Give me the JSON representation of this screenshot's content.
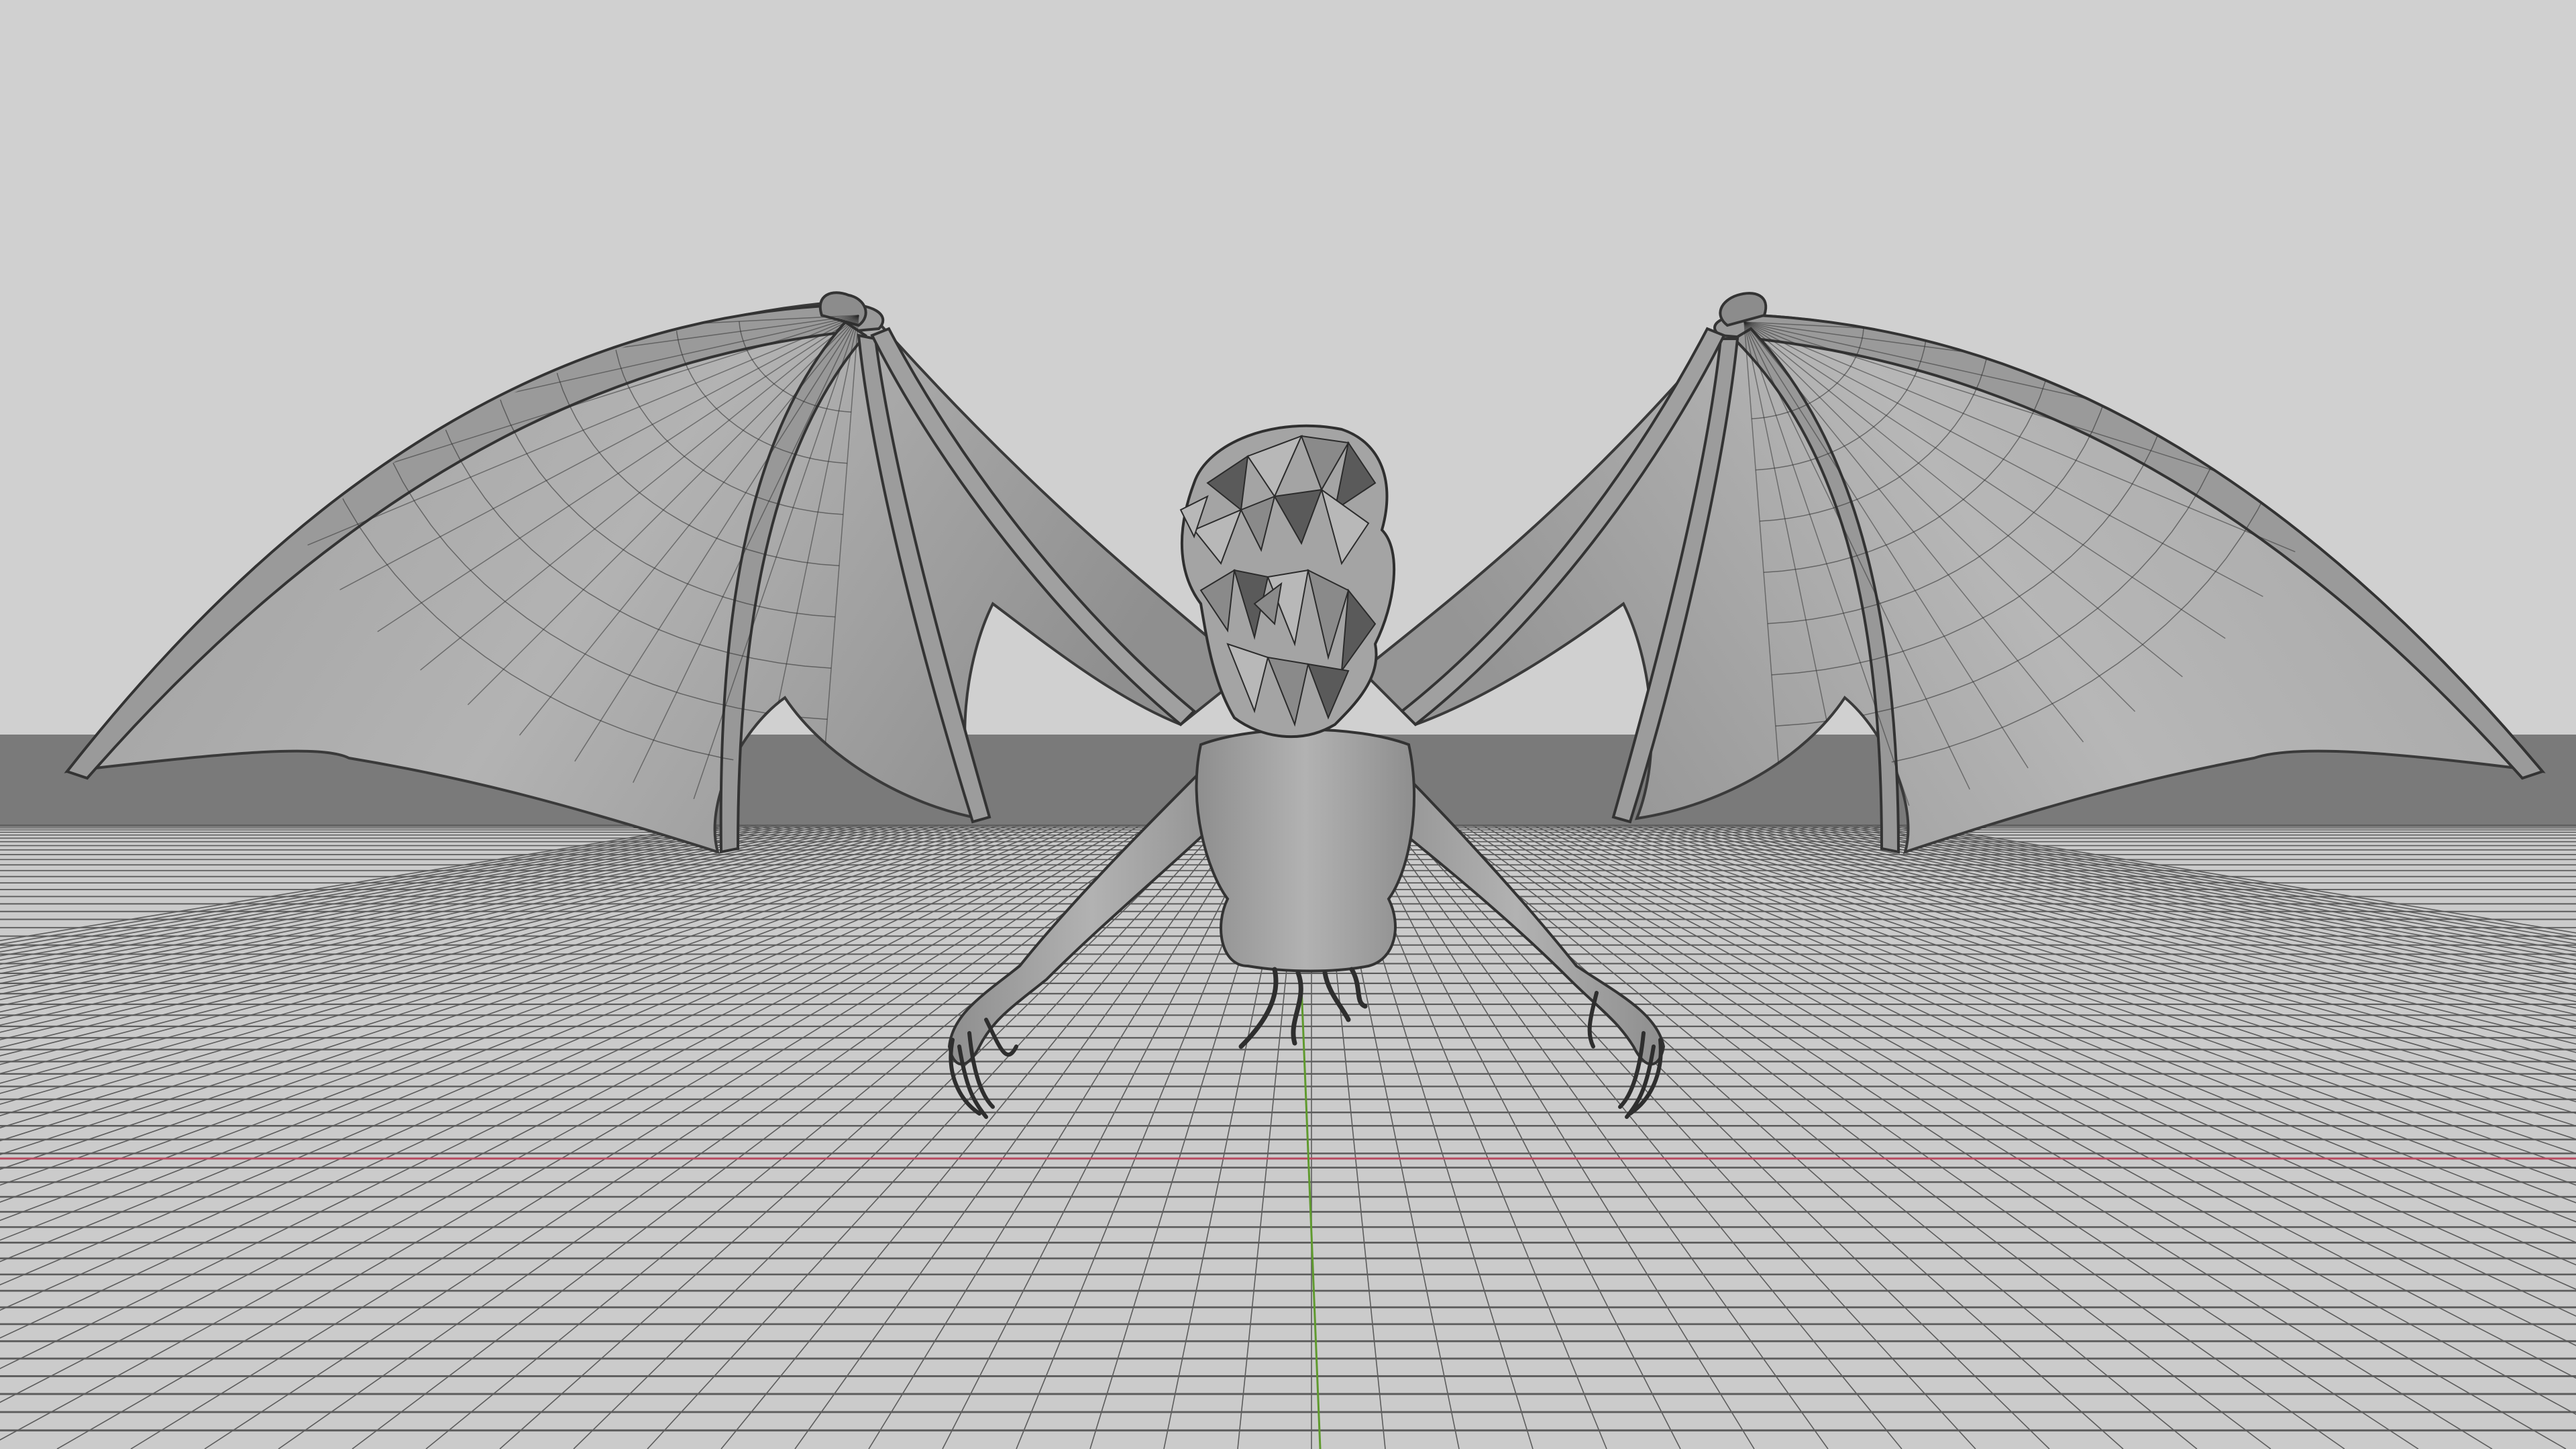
{
  "viewport": {
    "background_color": "#d0d0d0",
    "floor_color": "#cbcbcb",
    "horizon_band_color": "#7a7a7a",
    "grid_line_color": "#5c5c5c",
    "x_axis_color": "#b8495f",
    "y_axis_color": "#5f9a2e",
    "grid_visible": true
  },
  "model": {
    "icon": "winged-creature-mesh",
    "display_mode": "wireframe-overlay",
    "surface_color": "#a9a9a9",
    "wire_color": "#2b2b2b"
  }
}
